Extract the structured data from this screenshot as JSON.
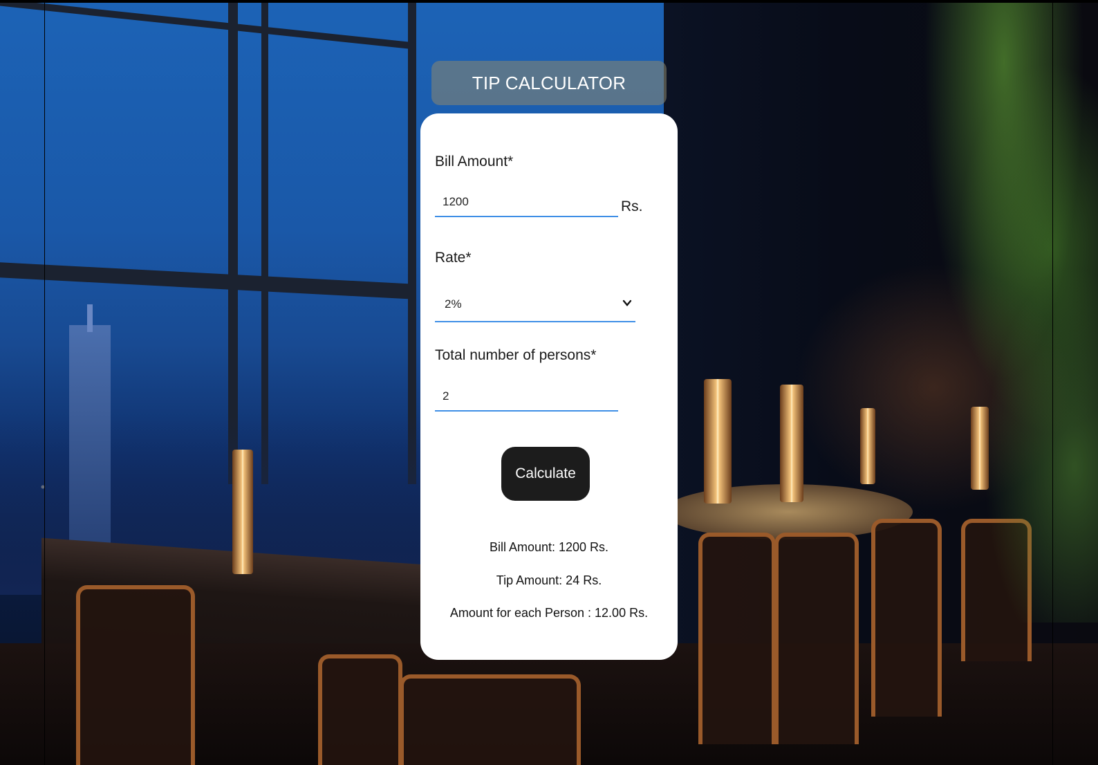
{
  "header": {
    "title": "TIP CALCULATOR"
  },
  "form": {
    "bill_label": "Bill Amount*",
    "bill_value": "1200",
    "bill_unit": "Rs.",
    "rate_label": "Rate*",
    "rate_selected": "2%",
    "persons_label": "Total number of persons*",
    "persons_value": "2",
    "calculate_label": "Calculate"
  },
  "results": {
    "bill_amount": "Bill Amount: 1200 Rs.",
    "tip_amount": "Tip Amount: 24 Rs.",
    "per_person": "Amount for each Person : 12.00 Rs."
  },
  "colors": {
    "accent_underline": "#3e8ee6",
    "button_bg": "#1c1c1c",
    "card_bg": "#ffffff"
  },
  "icons": {
    "select_arrow": "chevron-down-icon"
  }
}
